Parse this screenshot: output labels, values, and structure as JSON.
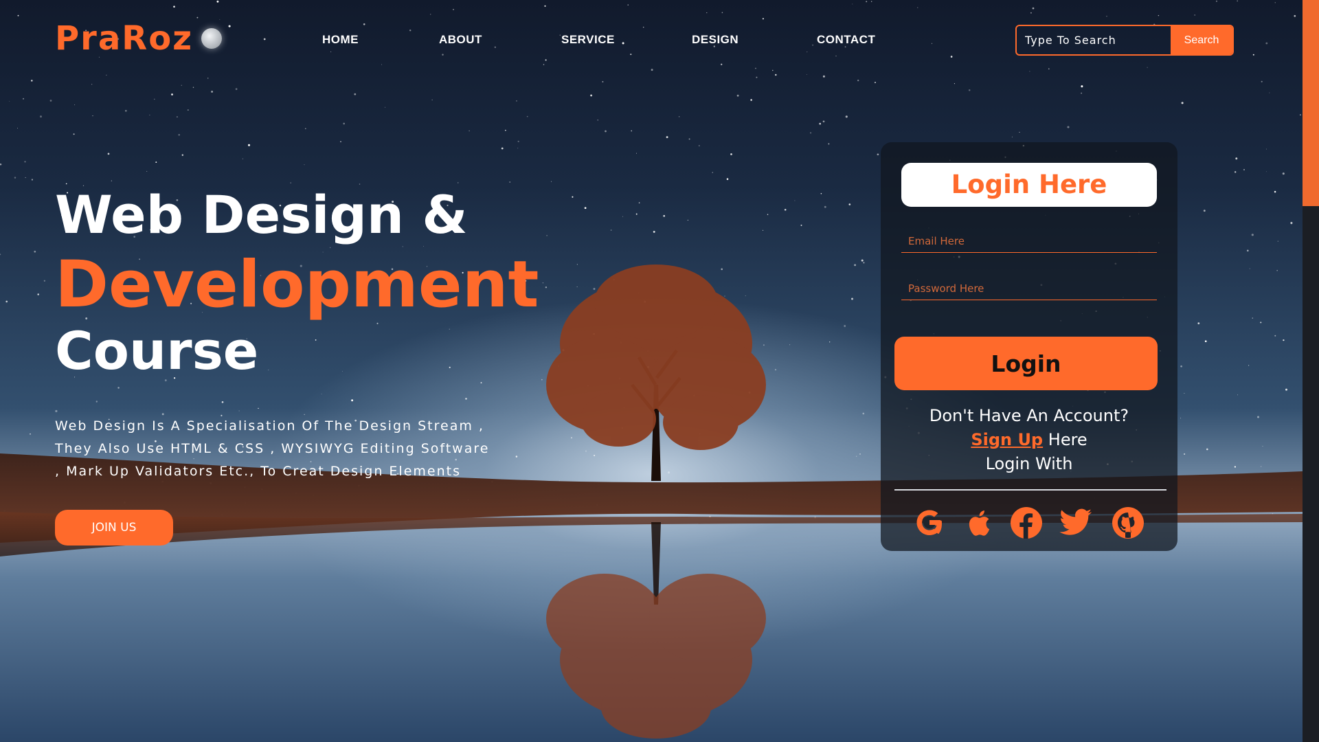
{
  "brand": {
    "name": "PraRoz"
  },
  "nav": {
    "links": [
      {
        "label": "HOME"
      },
      {
        "label": "ABOUT"
      },
      {
        "label": "SERVICE"
      },
      {
        "label": "DESIGN"
      },
      {
        "label": "CONTACT"
      }
    ]
  },
  "search": {
    "placeholder": "Type To Search",
    "button_label": "Search"
  },
  "hero": {
    "line1": "Web Design &",
    "line2": "Development",
    "line3": "Course",
    "description": "Web Design Is A Specialisation Of The Design Stream , They Also Use HTML & CSS , WYSIWYG Editing Software , Mark Up Validators Etc., To Creat Design Elements",
    "join_label": "JOIN US"
  },
  "login": {
    "title": "Login Here",
    "email_placeholder": "Email Here",
    "password_placeholder": "Password Here",
    "button_label": "Login",
    "no_account_text": "Don't Have An Account?",
    "signup_label": "Sign Up",
    "signup_suffix": "Here",
    "login_with_text": "Login With",
    "social": [
      {
        "icon": "google-icon"
      },
      {
        "icon": "apple-icon"
      },
      {
        "icon": "facebook-icon"
      },
      {
        "icon": "twitter-icon"
      },
      {
        "icon": "github-icon"
      }
    ]
  },
  "colors": {
    "accent": "#ff6a2b",
    "card_bg": "#11161e",
    "sky_dark": "#111a2c",
    "tree": "#8a3e22"
  }
}
